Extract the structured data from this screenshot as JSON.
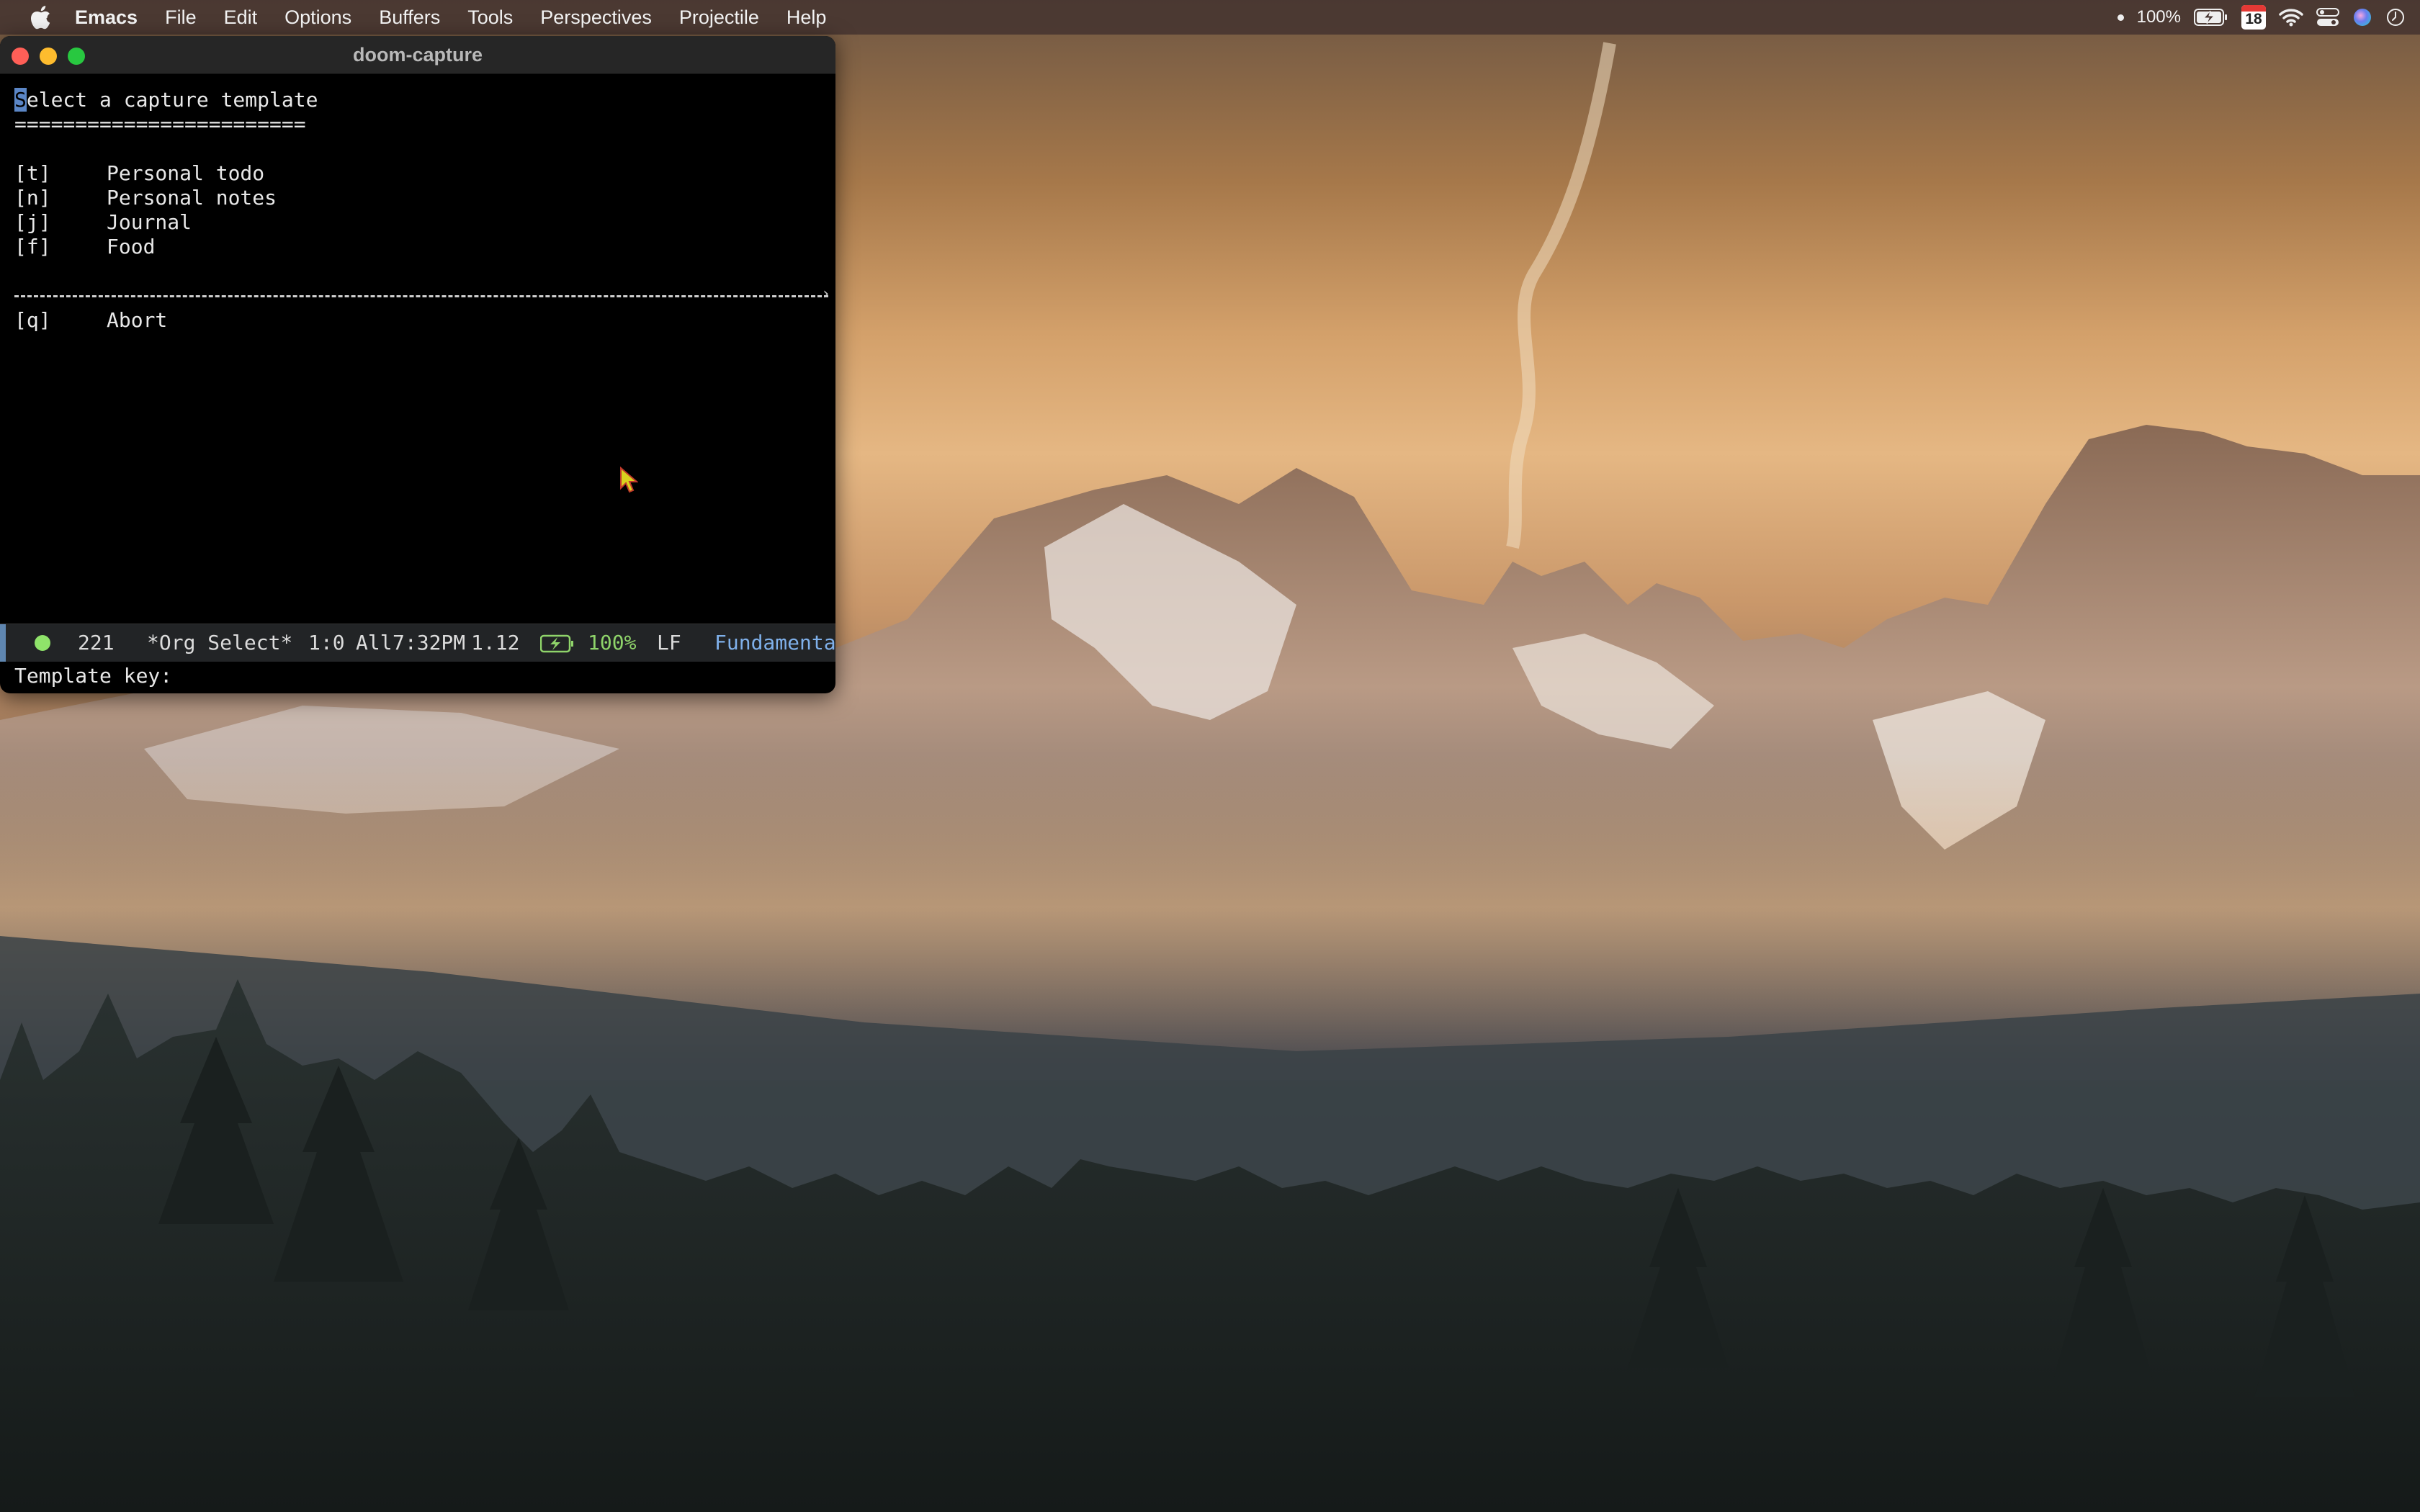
{
  "menubar": {
    "apple_icon": "apple-icon",
    "items": [
      "Emacs",
      "File",
      "Edit",
      "Options",
      "Buffers",
      "Tools",
      "Perspectives",
      "Projectile",
      "Help"
    ],
    "status": {
      "battery_percent": "100%",
      "calendar_day": "18",
      "icons": [
        "dot-icon",
        "battery-charging-icon",
        "calendar-icon",
        "wifi-icon",
        "control-center-icon",
        "siri-icon",
        "clock-icon"
      ]
    }
  },
  "window": {
    "title": "doom-capture"
  },
  "buffer": {
    "heading_first_char": "S",
    "heading_rest": "elect a capture template",
    "underline": "========================",
    "options": [
      {
        "key": "[t]",
        "label": "Personal todo"
      },
      {
        "key": "[n]",
        "label": "Personal notes"
      },
      {
        "key": "[j]",
        "label": "Journal"
      },
      {
        "key": "[f]",
        "label": "Food"
      }
    ],
    "abort": {
      "key": "[q]",
      "label": "Abort"
    }
  },
  "modeline": {
    "line_count": "221",
    "buffer_name": "*Org Select*",
    "position": "1:0",
    "scroll": "All",
    "time": "7:32PM",
    "load": "1.12",
    "battery": "100%",
    "eol": "LF",
    "major_mode": "Fundamenta"
  },
  "minibuffer": {
    "prompt": "Template key:"
  },
  "colors": {
    "menubar_bg": "#463430",
    "modeline_dot": "#8fe36a",
    "major_mode": "#7fb0ea",
    "cursor": "#5b86c6"
  }
}
